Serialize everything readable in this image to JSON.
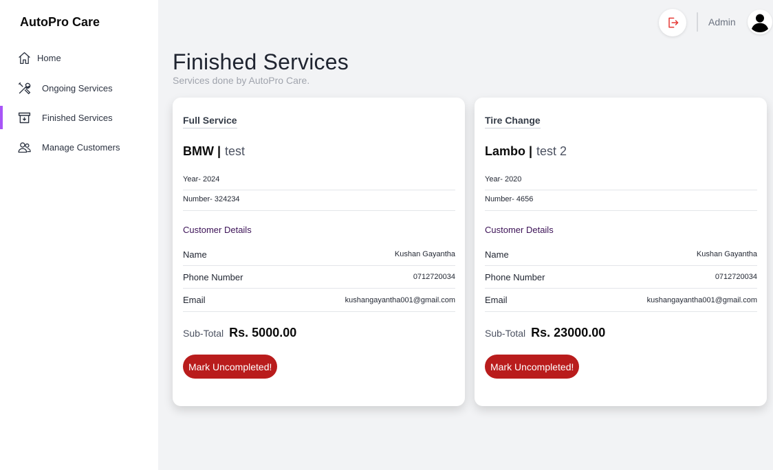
{
  "app": {
    "brand": "AutoPro Care"
  },
  "sidebar": {
    "items": [
      {
        "label": "Home",
        "icon": "home-icon"
      },
      {
        "label": "Ongoing Services",
        "icon": "tools-icon"
      },
      {
        "label": "Finished Services",
        "icon": "archive-icon",
        "active": true
      },
      {
        "label": "Manage Customers",
        "icon": "users-icon"
      }
    ],
    "active_color": "#a855f7"
  },
  "topbar": {
    "user_label": "Admin",
    "logout_icon": "logout-icon",
    "avatar_icon": "user-avatar-icon"
  },
  "page": {
    "title": "Finished Services",
    "subtitle": "Services done by AutoPro Care."
  },
  "labels": {
    "customer_details": "Customer Details",
    "name": "Name",
    "phone": "Phone Number",
    "email": "Email",
    "subtotal": "Sub-Total",
    "mark_button": "Mark Uncompleted!"
  },
  "cards": [
    {
      "service": "Full Service",
      "brand": "BMW |",
      "model": "test",
      "year": "Year- 2024",
      "number": "Number- 324234",
      "customer_name": "Kushan Gayantha",
      "customer_phone": "0712720034",
      "customer_email": "kushangayantha001@gmail.com",
      "subtotal": "Rs. 5000.00"
    },
    {
      "service": "Tire Change",
      "brand": "Lambo |",
      "model": "test 2",
      "year": "Year- 2020",
      "number": "Number- 4656",
      "customer_name": "Kushan Gayantha",
      "customer_phone": "0712720034",
      "customer_email": "kushangayantha001@gmail.com",
      "subtotal": "Rs. 23000.00"
    }
  ],
  "colors": {
    "button": "#b91c1c",
    "heading_accent": "#3b1156"
  }
}
